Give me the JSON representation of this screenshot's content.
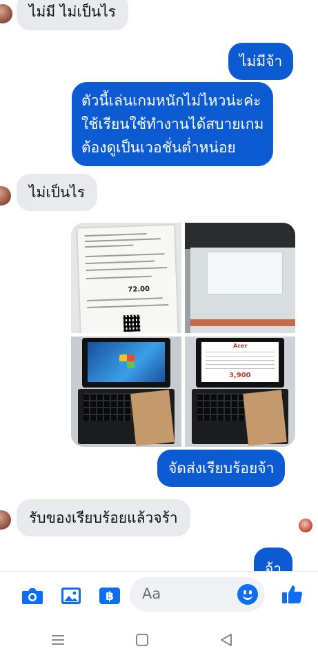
{
  "conversation": {
    "messages": [
      {
        "side": "in",
        "text": "ไม่มี ไม่เป็นไร"
      },
      {
        "side": "out",
        "text": "ไม่มีจ้า"
      },
      {
        "side": "out",
        "lines": [
          "ตัวนี้เล่นเกมหนักไม่ไหวน่ะค่ะ",
          "ใช้เรียนใช้ทำงานได้สบายเกม",
          "ต้องดูเป็นเวอชั่นต่ำหน่อย"
        ]
      },
      {
        "side": "in",
        "text": "ไม่เป็นไร"
      },
      {
        "side": "out",
        "text": "จัดส่งเรียบร้อยจ้า"
      },
      {
        "side": "in",
        "text": "รับของเรียบร้อยแล้วจร้า"
      },
      {
        "side": "out",
        "text": "จ้า"
      }
    ],
    "photos": {
      "receipt_total": "72.00",
      "spec_brand": "Acer",
      "spec_price": "3,900"
    }
  },
  "composer": {
    "placeholder": "Aa",
    "accent": "#0d6ef2"
  },
  "icons": [
    "camera-icon",
    "image-icon",
    "baht-payment-icon",
    "emoji-icon",
    "thumbs-up-icon",
    "nav-menu-icon",
    "nav-home-icon",
    "nav-back-icon"
  ]
}
